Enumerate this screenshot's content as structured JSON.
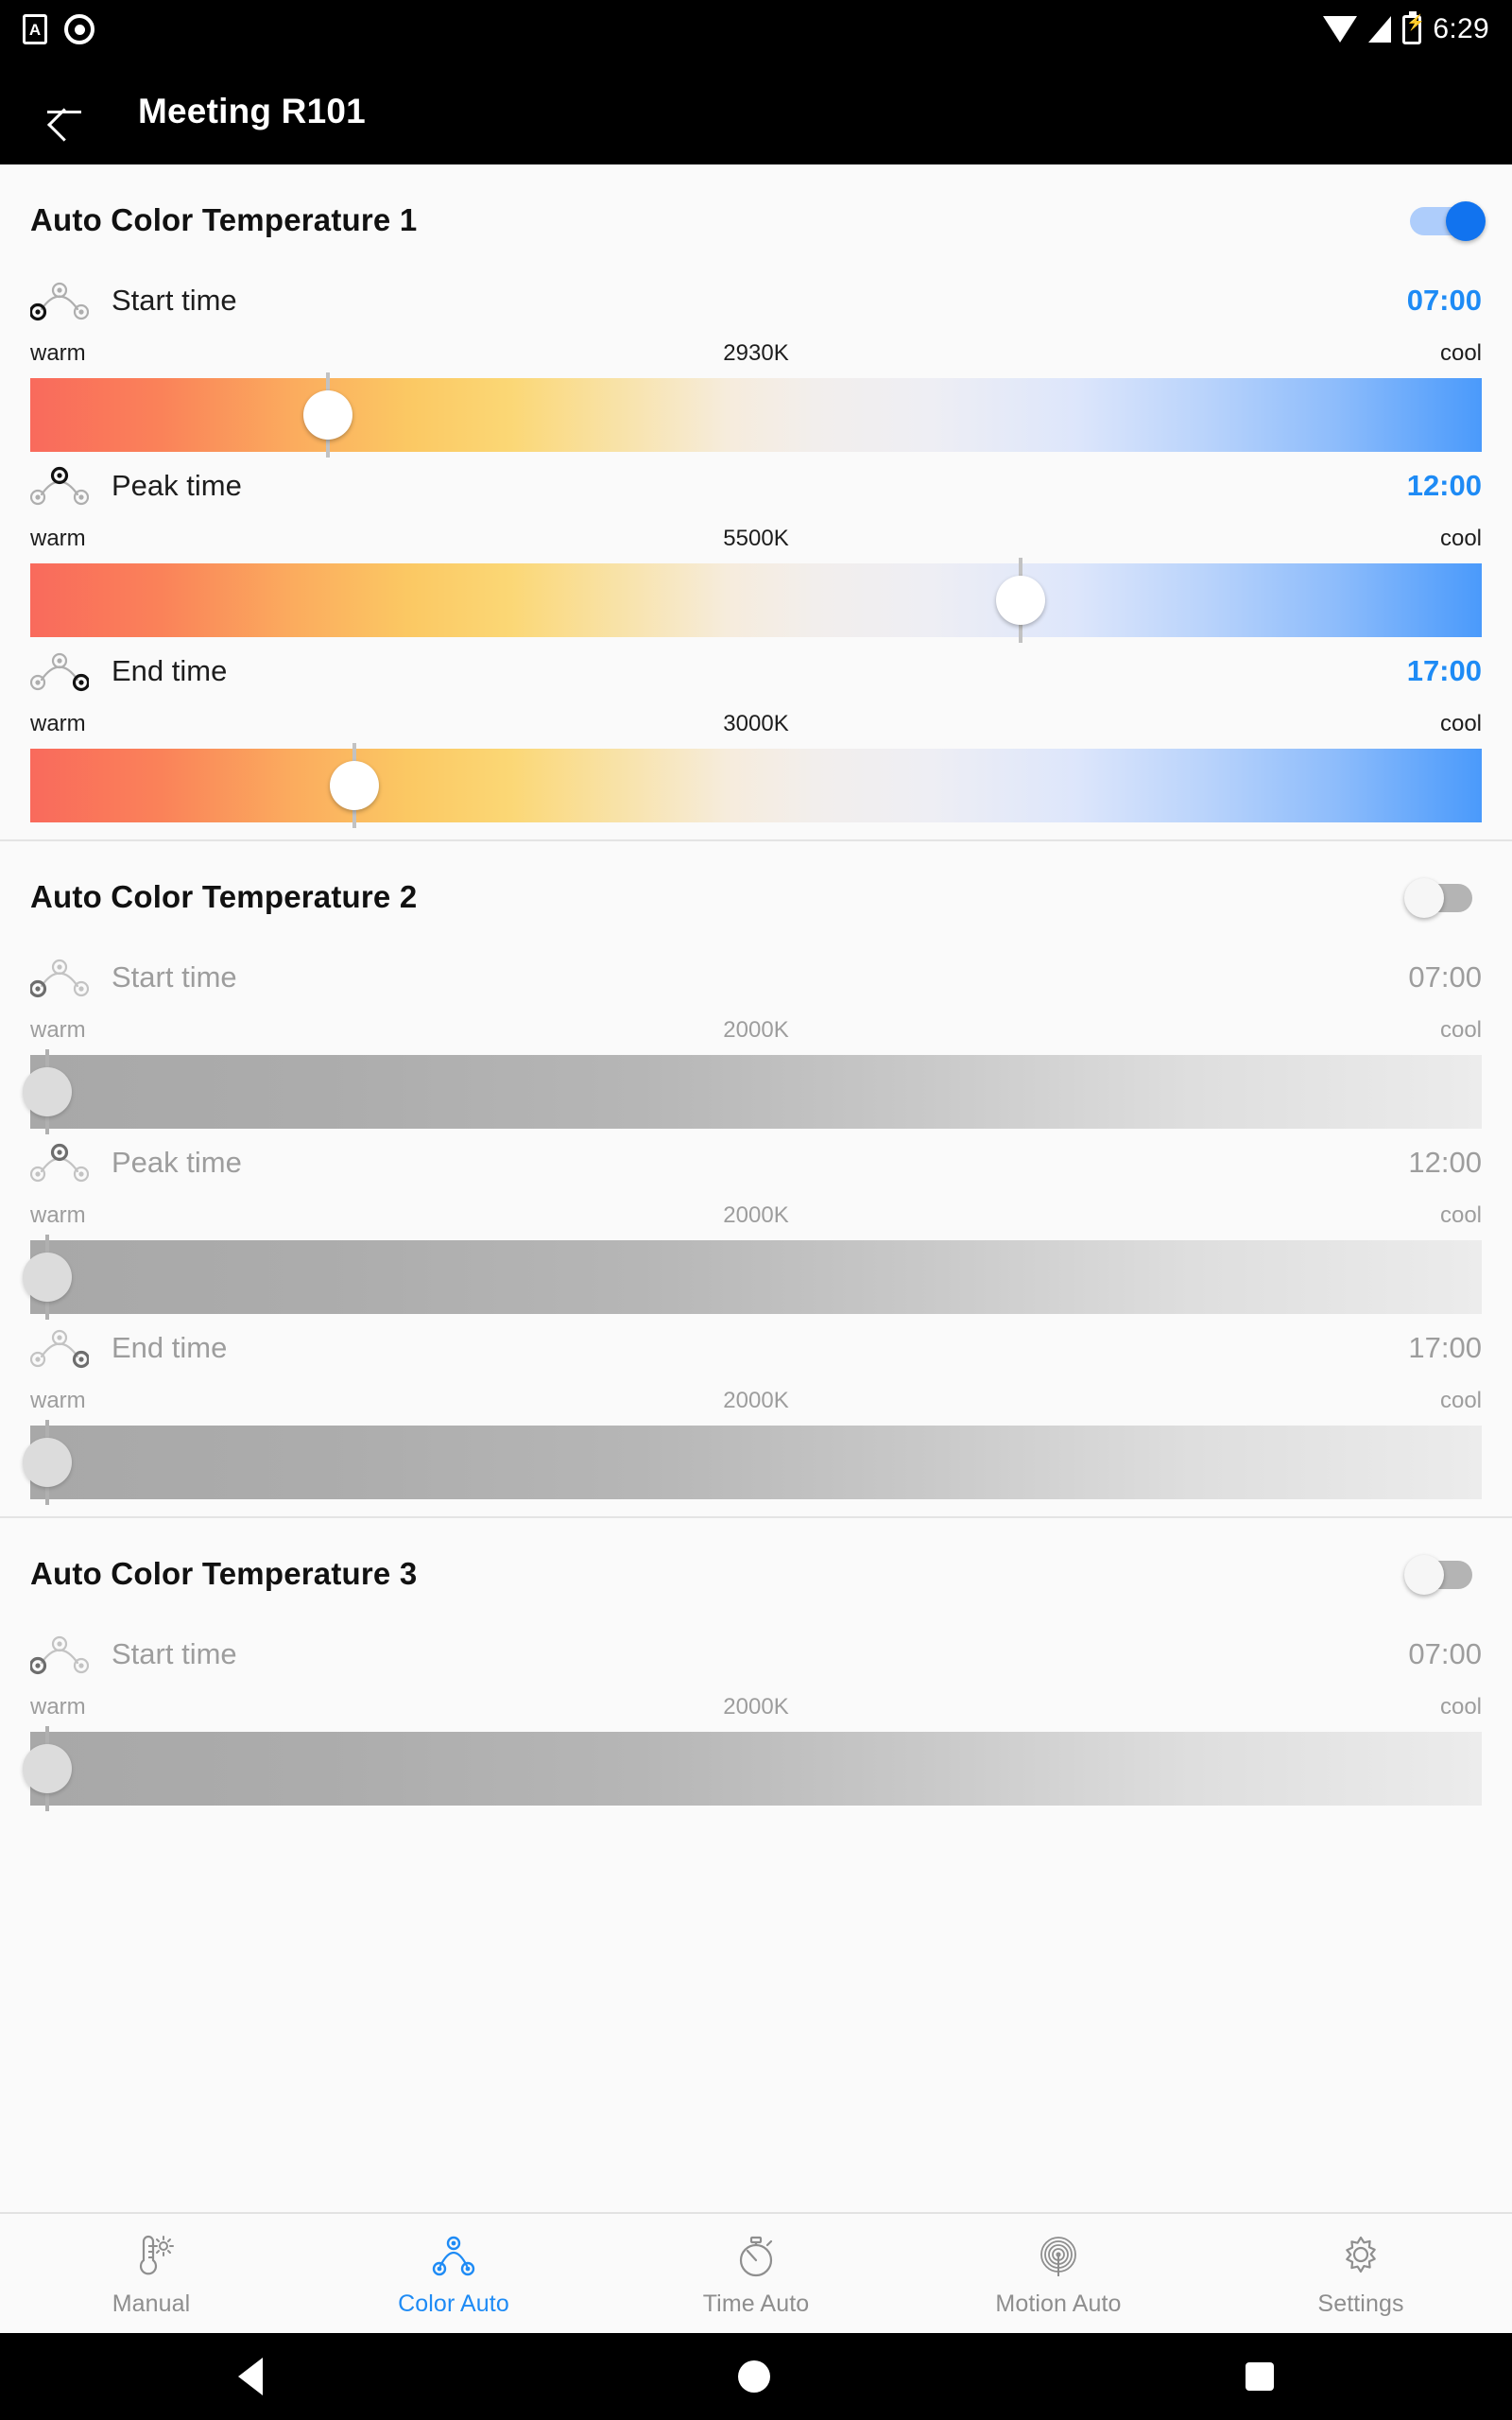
{
  "status_bar": {
    "time": "6:29",
    "icons": [
      "app-notification-icon",
      "record-icon",
      "wifi-icon",
      "cellular-signal-icon",
      "battery-charging-icon"
    ]
  },
  "app_bar": {
    "back_label": "back-arrow-icon",
    "title": "Meeting R101"
  },
  "legend": {
    "warm": "warm",
    "cool": "cool"
  },
  "sections": [
    {
      "title": "Auto Color Temperature 1",
      "enabled": true,
      "toggle_state": "on",
      "rows": [
        {
          "icon": "arc-start-icon",
          "label": "Start time",
          "time": "07:00",
          "kelvin": "2930K",
          "value_pct": 20.5
        },
        {
          "icon": "arc-peak-icon",
          "label": "Peak time",
          "time": "12:00",
          "kelvin": "5500K",
          "value_pct": 68.2
        },
        {
          "icon": "arc-end-icon",
          "label": "End time",
          "time": "17:00",
          "kelvin": "3000K",
          "value_pct": 22.3
        }
      ]
    },
    {
      "title": "Auto Color Temperature 2",
      "enabled": false,
      "toggle_state": "off",
      "rows": [
        {
          "icon": "arc-start-icon",
          "label": "Start time",
          "time": "07:00",
          "kelvin": "2000K",
          "value_pct": 1.2
        },
        {
          "icon": "arc-peak-icon",
          "label": "Peak time",
          "time": "12:00",
          "kelvin": "2000K",
          "value_pct": 1.2
        },
        {
          "icon": "arc-end-icon",
          "label": "End time",
          "time": "17:00",
          "kelvin": "2000K",
          "value_pct": 1.2
        }
      ]
    },
    {
      "title": "Auto Color Temperature 3",
      "enabled": false,
      "toggle_state": "off",
      "rows": [
        {
          "icon": "arc-start-icon",
          "label": "Start time",
          "time": "07:00",
          "kelvin": "2000K",
          "value_pct": 1.2
        }
      ]
    }
  ],
  "bottom_nav": {
    "active_index": 1,
    "items": [
      {
        "icon": "thermometer-sun-icon",
        "label": "Manual"
      },
      {
        "icon": "color-arc-icon",
        "label": "Color Auto"
      },
      {
        "icon": "stopwatch-icon",
        "label": "Time Auto"
      },
      {
        "icon": "motion-radar-icon",
        "label": "Motion Auto"
      },
      {
        "icon": "gear-icon",
        "label": "Settings"
      }
    ]
  },
  "system_nav": {
    "back": "system-back-icon",
    "home": "system-home-icon",
    "recents": "system-recents-icon"
  },
  "colors": {
    "accent": "#1e8bf5",
    "toggle_on": "#1173ef",
    "header_bg": "#000000",
    "page_bg": "#fafafa",
    "warm_end": "#f96a5c",
    "cool_end": "#4a9afb"
  }
}
